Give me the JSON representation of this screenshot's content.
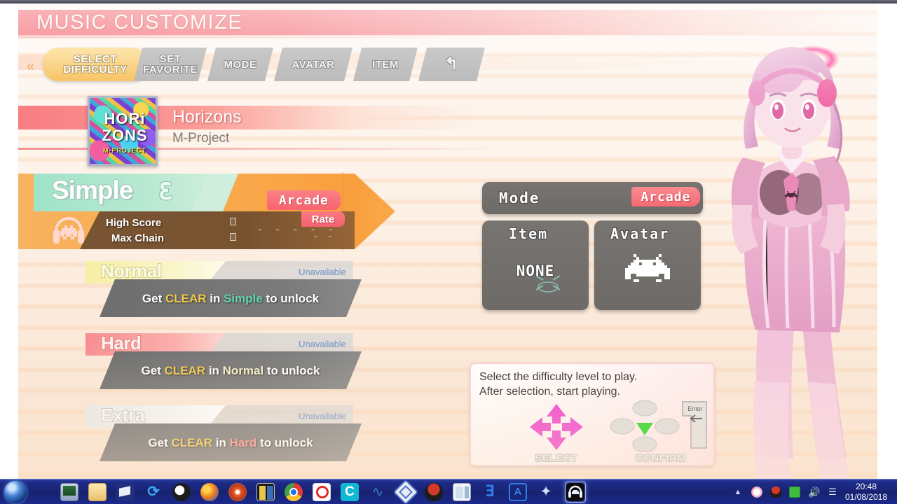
{
  "window": {
    "title": "MUSIC CUSTOMIZE"
  },
  "nav": {
    "chevron_left": "«",
    "chevron_right": "»",
    "tabs": [
      {
        "name": "select-difficulty",
        "line1": "SELECT",
        "line2": "DIFFICULTY",
        "active": true
      },
      {
        "name": "set-favorite",
        "line1": "SET",
        "line2": "FAVORITE",
        "active": false
      },
      {
        "name": "mode",
        "line1": "MODE",
        "line2": "",
        "active": false
      },
      {
        "name": "avatar",
        "line1": "AVATAR",
        "line2": "",
        "active": false
      },
      {
        "name": "item",
        "line1": "ITEM",
        "line2": "",
        "active": false
      },
      {
        "name": "back",
        "line1": "↰",
        "line2": "",
        "active": false
      }
    ]
  },
  "song": {
    "title": "Horizons",
    "artist": "M-Project",
    "jacket_line1": "HORi",
    "jacket_line2": "ZONS",
    "jacket_line3": "M-PROJECT"
  },
  "difficulties": [
    {
      "name": "Simple",
      "level": "3",
      "selected": true,
      "mode_badge": "Arcade",
      "high_score_label": "High Score",
      "max_chain_label": "Max Chain",
      "score_value": "- - - - -",
      "rate_label": "Rate",
      "rate_value": "- -"
    },
    {
      "name": "Normal",
      "status": "Unavailable",
      "unlock_prefix": "Get ",
      "unlock_clear": "CLEAR",
      "unlock_mid": " in ",
      "unlock_target": "Simple",
      "unlock_suffix": " to unlock"
    },
    {
      "name": "Hard",
      "status": "Unavailable",
      "unlock_prefix": "Get ",
      "unlock_clear": "CLEAR",
      "unlock_mid": " in ",
      "unlock_target": "Normal",
      "unlock_suffix": " to unlock"
    },
    {
      "name": "Extra",
      "status": "Unavailable",
      "unlock_prefix": "Get ",
      "unlock_clear": "CLEAR",
      "unlock_mid": " in ",
      "unlock_target": "Hard",
      "unlock_suffix": " to unlock"
    }
  ],
  "panels": {
    "mode": {
      "label": "Mode",
      "value": "Arcade"
    },
    "item": {
      "label": "Item",
      "value": "NONE"
    },
    "avatar": {
      "label": "Avatar",
      "value": "space-invader-sprite"
    }
  },
  "help": {
    "line1": "Select the difficulty level to play.",
    "line2": "After selection, start playing.",
    "select_caption": "SELECT",
    "confirm_caption": "CONFIRM",
    "enter_key_label": "Enter"
  },
  "colors": {
    "accent_pink": "#f4616b",
    "accent_orange": "#f6b94b",
    "simple_green": "#9fe3c9",
    "normal_yellow": "#f6efa4",
    "hard_red": "#f78e92",
    "extra_white": "#e8e8e8",
    "clear_gold": "#f3c84b",
    "unavailable_blue": "#6f93c4",
    "taskbar_blue": "#1d2b86"
  },
  "taskbar": {
    "start_button": "start-orb",
    "apps": [
      "display-settings-icon",
      "folder-icon",
      "file-explorer-icon",
      "sync-icon",
      "bee-search-icon",
      "firefox-icon",
      "snail-icon",
      "vending-machine-icon",
      "chrome-icon",
      "spiral-dfmirage-icon",
      "c-app-icon",
      "dolphin-icon",
      "diamond-icon",
      "helmet-icon",
      "window-icon",
      "e-logo-icon",
      "a-logo-icon",
      "ppsspp-icon",
      "groove-coaster-icon"
    ],
    "active_app": "groove-coaster-icon",
    "tray": [
      "show-hidden-icon",
      "circle-icon",
      "shield-icon",
      "battery-icon",
      "volume-icon",
      "network-icon"
    ],
    "clock_time": "20:48",
    "clock_date": "01/08/2018"
  }
}
